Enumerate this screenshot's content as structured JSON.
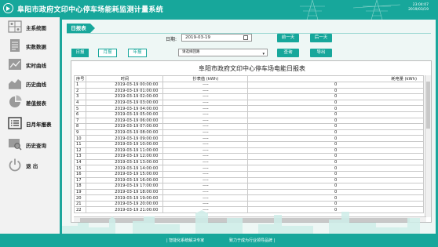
{
  "header": {
    "title": "阜阳市政府文印中心停车场能耗监测计量系统",
    "time": "23:04:07",
    "date": "2019/03/19"
  },
  "sidebar": {
    "items": [
      {
        "label": "主系统图",
        "icon": "grid-icon"
      },
      {
        "label": "实数数据",
        "icon": "document-icon"
      },
      {
        "label": "实时曲线",
        "icon": "line-chart-icon"
      },
      {
        "label": "历史曲线",
        "icon": "area-chart-icon"
      },
      {
        "label": "差值报表",
        "icon": "pie-chart-icon"
      },
      {
        "label": "日月年报表",
        "icon": "list-icon"
      },
      {
        "label": "历史查询",
        "icon": "search-icon"
      },
      {
        "label": "退    出",
        "icon": "power-icon"
      }
    ]
  },
  "toolbar": {
    "tab": "日报表",
    "date_label": "日期:",
    "date_value": "2019-03-19",
    "prev_day": "前一天",
    "next_day": "后一天",
    "mode_day": "日报",
    "mode_month": "月报",
    "mode_year": "年报",
    "meter_value": "请选择回路",
    "query": "查询",
    "export": "导出"
  },
  "report": {
    "title": "阜阳市政府文印中心停车场电能日报表",
    "columns": [
      "序号",
      "时间",
      "抄表值 (kWh)",
      "耗电量 (kWh)"
    ],
    "rows": [
      {
        "no": "1",
        "time": "2019-03-19 00:00:00",
        "reading": "----",
        "energy": "0"
      },
      {
        "no": "2",
        "time": "2019-03-19 01:00:00",
        "reading": "----",
        "energy": "0"
      },
      {
        "no": "3",
        "time": "2019-03-19 02:00:00",
        "reading": "----",
        "energy": "0"
      },
      {
        "no": "4",
        "time": "2019-03-19 03:00:00",
        "reading": "----",
        "energy": "0"
      },
      {
        "no": "5",
        "time": "2019-03-19 04:00:00",
        "reading": "----",
        "energy": "0"
      },
      {
        "no": "6",
        "time": "2019-03-19 05:00:00",
        "reading": "----",
        "energy": "0"
      },
      {
        "no": "7",
        "time": "2019-03-19 06:00:00",
        "reading": "----",
        "energy": "0"
      },
      {
        "no": "8",
        "time": "2019-03-19 07:00:00",
        "reading": "----",
        "energy": "0"
      },
      {
        "no": "9",
        "time": "2019-03-19 08:00:00",
        "reading": "----",
        "energy": "0"
      },
      {
        "no": "10",
        "time": "2019-03-19 09:00:00",
        "reading": "----",
        "energy": "0"
      },
      {
        "no": "11",
        "time": "2019-03-19 10:00:00",
        "reading": "----",
        "energy": "0"
      },
      {
        "no": "12",
        "time": "2019-03-19 11:00:00",
        "reading": "----",
        "energy": "0"
      },
      {
        "no": "13",
        "time": "2019-03-19 12:00:00",
        "reading": "----",
        "energy": "0"
      },
      {
        "no": "14",
        "time": "2019-03-19 13:00:00",
        "reading": "----",
        "energy": "0"
      },
      {
        "no": "15",
        "time": "2019-03-19 14:00:00",
        "reading": "----",
        "energy": "0"
      },
      {
        "no": "16",
        "time": "2019-03-19 15:00:00",
        "reading": "----",
        "energy": "0"
      },
      {
        "no": "17",
        "time": "2019-03-19 16:00:00",
        "reading": "----",
        "energy": "0"
      },
      {
        "no": "18",
        "time": "2019-03-19 17:00:00",
        "reading": "----",
        "energy": "0"
      },
      {
        "no": "19",
        "time": "2019-03-19 18:00:00",
        "reading": "----",
        "energy": "0"
      },
      {
        "no": "20",
        "time": "2019-03-19 19:00:00",
        "reading": "----",
        "energy": "0"
      },
      {
        "no": "21",
        "time": "2019-03-19 20:00:00",
        "reading": "----",
        "energy": "0"
      },
      {
        "no": "22",
        "time": "2019-03-19 21:00:00",
        "reading": "----",
        "energy": "0"
      }
    ]
  },
  "footer": {
    "left": "| 智能化系统解决专家",
    "right": "致力于成为行业领导品牌 |"
  },
  "colors": {
    "accent": "#17a79b",
    "panel": "#eef7f5",
    "sidebar": "#f2f2f2"
  }
}
